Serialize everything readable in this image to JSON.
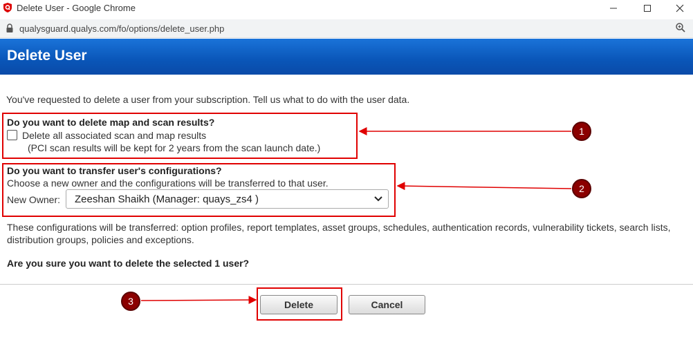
{
  "window": {
    "title": "Delete User - Google Chrome",
    "url": "qualysguard.qualys.com/fo/options/delete_user.php"
  },
  "header": {
    "title": "Delete User"
  },
  "intro": "You've requested to delete a user from your subscription. Tell us what to do with the user data.",
  "section1": {
    "question": "Do you want to delete map and scan results?",
    "checkbox_label": "Delete all associated scan and map results",
    "checkbox_checked": false,
    "note": "(PCI scan results will be kept for 2 years from the scan launch date.)"
  },
  "section2": {
    "question": "Do you want to transfer user's configurations?",
    "text": "Choose a new owner and the configurations will be transferred to that user.",
    "owner_label": "New Owner:",
    "owner_value": "Zeeshan Shaikh (Manager: quays_zs4 )"
  },
  "transfer_text": "These configurations will be transferred: option profiles, report templates, asset groups, schedules, authentication records, vulnerability tickets, search lists, distribution groups, policies and exceptions.",
  "confirm": "Are you sure you want to delete the selected 1 user?",
  "buttons": {
    "delete": "Delete",
    "cancel": "Cancel"
  },
  "annotations": [
    "1",
    "2",
    "3"
  ],
  "colors": {
    "header_blue": "#0a56b8",
    "annotation_red": "#e00000",
    "marker": "#8b0000"
  }
}
